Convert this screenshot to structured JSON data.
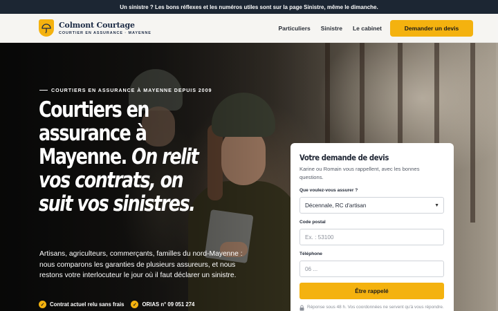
{
  "topbar": {
    "message": "Un sinistre ? Les bons réflexes et les numéros utiles sont sur la page Sinistre, même le dimanche."
  },
  "brand": {
    "name": "Colmont Courtage",
    "tagline": "COURTIER EN ASSURANCE · MAYENNE",
    "accent": "#f4b20f",
    "navy": "#1c2b45"
  },
  "nav": {
    "items": [
      "Particuliers",
      "Sinistre",
      "Le cabinet"
    ],
    "cta": "Demander un devis"
  },
  "hero": {
    "eyebrow": "COURTIERS EN ASSURANCE À MAYENNE DEPUIS 2009",
    "headline_line1": "Courtiers en",
    "headline_line2": "assurance à",
    "headline_line3": "Mayenne.",
    "headline_italic1": "On relit",
    "headline_italic2": "vos contrats, on",
    "headline_italic3": "suit vos sinistres.",
    "lead": "Artisans, agriculteurs, commerçants, familles du nord-Mayenne : nous comparons les garanties de plusieurs assureurs, et nous restons votre interlocuteur le jour où il faut déclarer un sinistre.",
    "checks": [
      "Contrat actuel relu sans frais",
      "ORIAS n° 09 051 274"
    ]
  },
  "form": {
    "title": "Votre demande de devis",
    "intro": "Karine ou Romain vous rappellent, avec les bonnes questions.",
    "q1_label": "Que voulez-vous assurer ?",
    "q1_value": "Décennale, RC d'artisan",
    "postal_label": "Code postal",
    "postal_placeholder": "Ex. : 53100",
    "phone_label": "Téléphone",
    "phone_placeholder": "06 ...",
    "submit": "Être rappelé",
    "note": "Réponse sous 48 h. Vos coordonnées ne servent qu'à vous répondre."
  },
  "icons": {
    "logo": "umbrella-shield-icon",
    "check": "check-circle-icon",
    "lock": "lock-icon",
    "select": "chevron-down-icon"
  }
}
